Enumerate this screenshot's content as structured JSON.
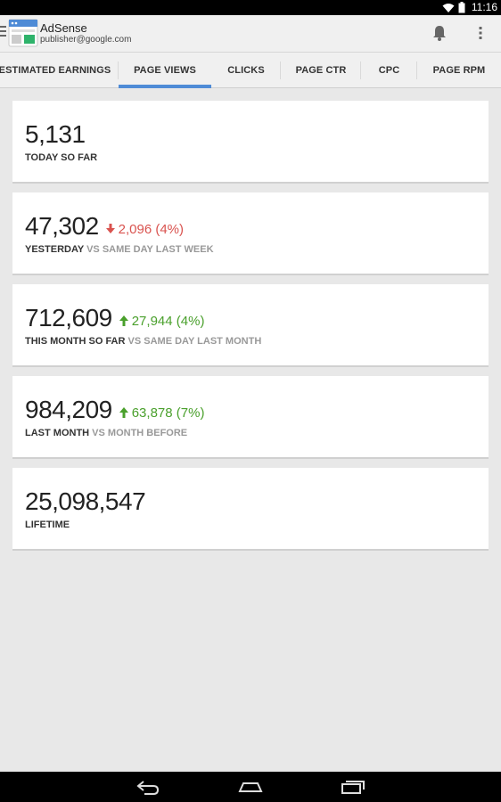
{
  "status_bar": {
    "time": "11:16"
  },
  "app_bar": {
    "title": "AdSense",
    "account": "publisher@google.com"
  },
  "tabs": [
    {
      "label": "ESTIMATED EARNINGS",
      "active": false
    },
    {
      "label": "PAGE VIEWS",
      "active": true
    },
    {
      "label": "CLICKS",
      "active": false
    },
    {
      "label": "PAGE CTR",
      "active": false
    },
    {
      "label": "CPC",
      "active": false
    },
    {
      "label": "PAGE RPM",
      "active": false
    }
  ],
  "cards": [
    {
      "value": "5,131",
      "delta": "",
      "direction": "",
      "label": "TODAY SO FAR",
      "sub": ""
    },
    {
      "value": "47,302",
      "delta": "2,096 (4%)",
      "direction": "down",
      "label": "YESTERDAY",
      "sub": "VS SAME DAY LAST WEEK"
    },
    {
      "value": "712,609",
      "delta": "27,944 (4%)",
      "direction": "up",
      "label": "THIS MONTH SO FAR",
      "sub": "VS SAME DAY LAST MONTH"
    },
    {
      "value": "984,209",
      "delta": "63,878 (7%)",
      "direction": "up",
      "label": "LAST MONTH",
      "sub": "VS MONTH BEFORE"
    },
    {
      "value": "25,098,547",
      "delta": "",
      "direction": "",
      "label": "LIFETIME",
      "sub": ""
    }
  ],
  "colors": {
    "accent": "#4e8bd6",
    "down": "#d9534f",
    "up": "#4aa02c"
  },
  "icons": [
    "wifi-icon",
    "battery-icon",
    "menu-icon",
    "adsense-logo-icon",
    "bell-icon",
    "overflow-menu-icon",
    "back-icon",
    "home-icon",
    "recents-icon"
  ]
}
